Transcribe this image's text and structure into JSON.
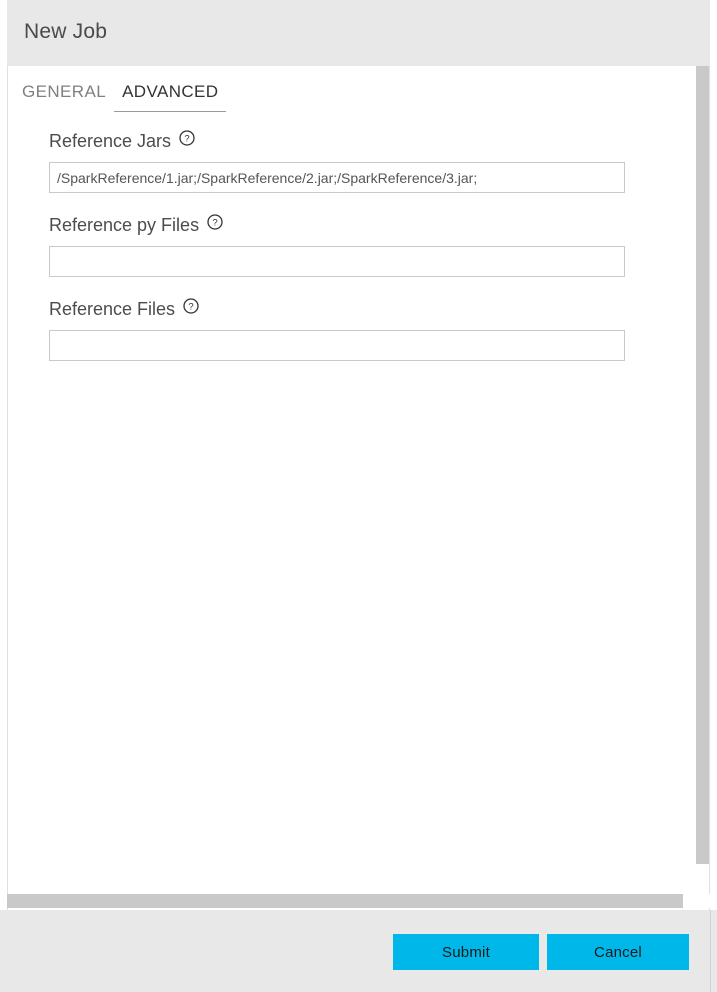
{
  "window": {
    "title": "New Job"
  },
  "tabs": [
    {
      "label": "GENERAL",
      "active": false
    },
    {
      "label": "ADVANCED",
      "active": true
    }
  ],
  "form": {
    "fields": [
      {
        "label": "Reference Jars",
        "help_icon": "question-circle-icon",
        "value": "/SparkReference/1.jar;/SparkReference/2.jar;/SparkReference/3.jar;",
        "placeholder": ""
      },
      {
        "label": "Reference py Files",
        "help_icon": "question-circle-icon",
        "value": "",
        "placeholder": ""
      },
      {
        "label": "Reference Files",
        "help_icon": "question-circle-icon",
        "value": "",
        "placeholder": ""
      }
    ]
  },
  "footer": {
    "submit_label": "Submit",
    "cancel_label": "Cancel"
  },
  "colors": {
    "accent": "#00b7ea",
    "header_bg": "#e8e8e8",
    "footer_bg": "#e8e8e8",
    "scrollbar_thumb": "#c9c9c9",
    "field_border": "#c9c9c9",
    "tab_active_text": "#333333",
    "tab_inactive_text": "#808080"
  }
}
